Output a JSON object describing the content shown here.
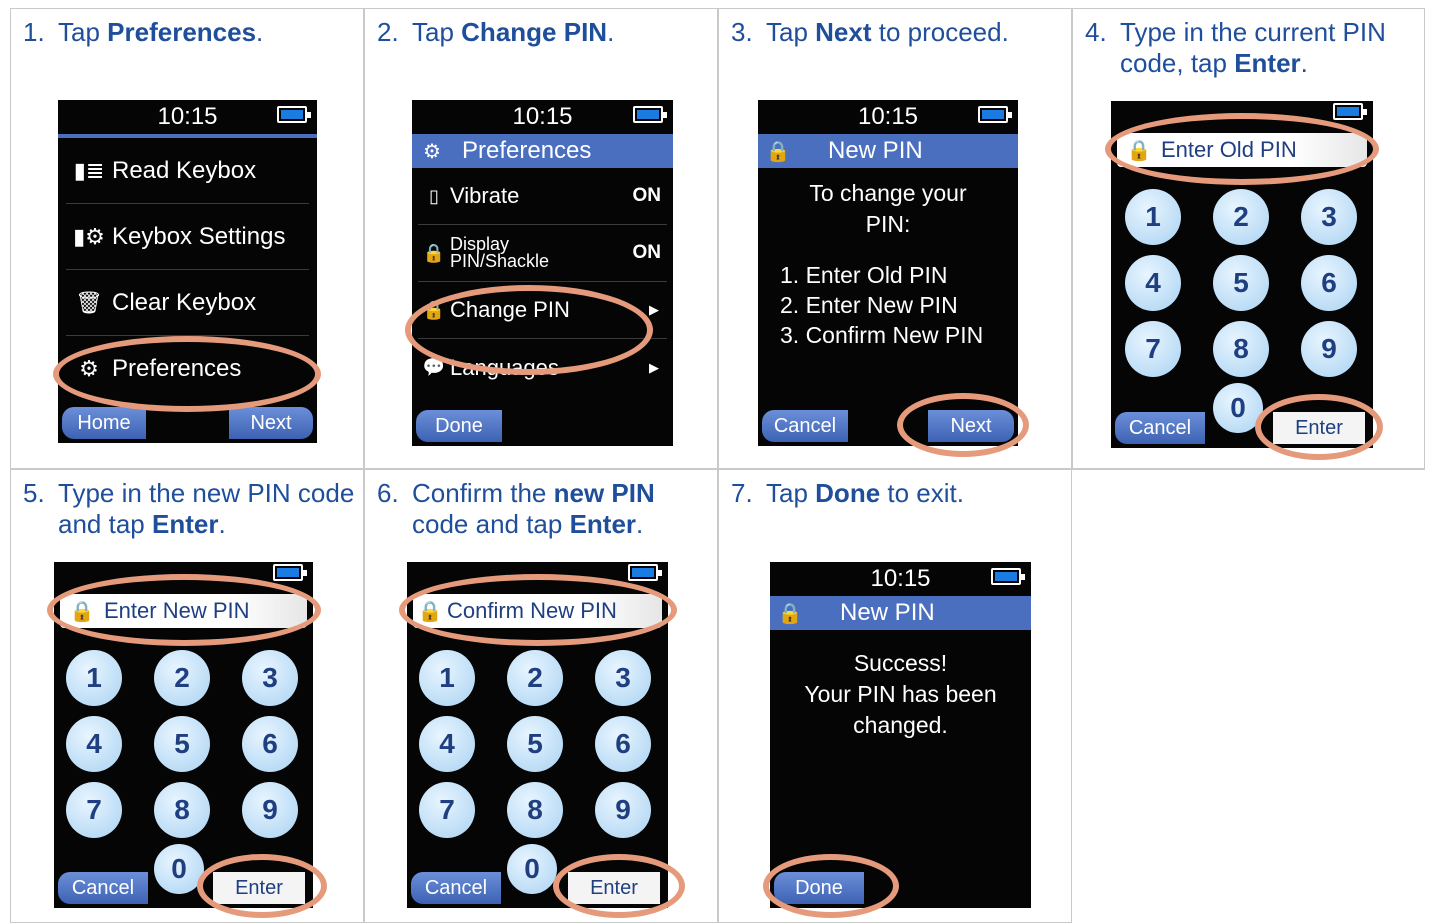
{
  "steps": [
    {
      "num": "1.",
      "pre": "Tap ",
      "bold": "Preferences",
      "post": "."
    },
    {
      "num": "2.",
      "pre": "Tap ",
      "bold": "Change PIN",
      "post": "."
    },
    {
      "num": "3.",
      "pre": "Tap ",
      "bold": "Next",
      "post": " to proceed."
    },
    {
      "num": "4.",
      "pre": "Type in the current PIN code, tap ",
      "bold": "Enter",
      "post": "."
    },
    {
      "num": "5.",
      "pre": "Type in the new PIN code and tap ",
      "bold": "Enter",
      "post": "."
    },
    {
      "num": "6.",
      "pre": "Confirm the ",
      "bold": "new PIN",
      "mid": " code and tap ",
      "bold2": "Enter",
      "post": "."
    },
    {
      "num": "7.",
      "pre": "Tap ",
      "bold": "Done",
      "post": " to exit."
    }
  ],
  "time": "10:15",
  "screen1": {
    "items": [
      "Read Keybox",
      "Keybox Settings",
      "Clear Keybox",
      "Preferences"
    ],
    "left_key": "Home",
    "right_key": "Next"
  },
  "screen2": {
    "title": "Preferences",
    "vibrate": "Vibrate",
    "vibrate_val": "ON",
    "display1": "Display",
    "display2": "PIN/Shackle",
    "display_val": "ON",
    "change_pin": "Change PIN",
    "languages": "Languages",
    "left_key": "Done"
  },
  "screen3": {
    "title": "New PIN",
    "intro1": "To change your",
    "intro2": "PIN:",
    "line1": "1. Enter Old PIN",
    "line2": "2. Enter New PIN",
    "line3": "3. Confirm New PIN",
    "left_key": "Cancel",
    "right_key": "Next"
  },
  "screen4": {
    "field": "Enter Old PIN",
    "left_key": "Cancel",
    "right_key": "Enter"
  },
  "screen5": {
    "field": "Enter New PIN",
    "left_key": "Cancel",
    "right_key": "Enter"
  },
  "screen6": {
    "field": "Confirm New PIN",
    "left_key": "Cancel",
    "right_key": "Enter"
  },
  "screen7": {
    "title": "New PIN",
    "msg1": "Success!",
    "msg2": "Your PIN has been",
    "msg3": "changed.",
    "left_key": "Done"
  },
  "keys": [
    "1",
    "2",
    "3",
    "4",
    "5",
    "6",
    "7",
    "8",
    "9",
    "0"
  ],
  "colors": {
    "instruction_text": "#1f4e9b",
    "highlight_ring": "#e69a7c",
    "title_bar": "#4a6fbf",
    "key_bg": "#a9d2f2"
  }
}
